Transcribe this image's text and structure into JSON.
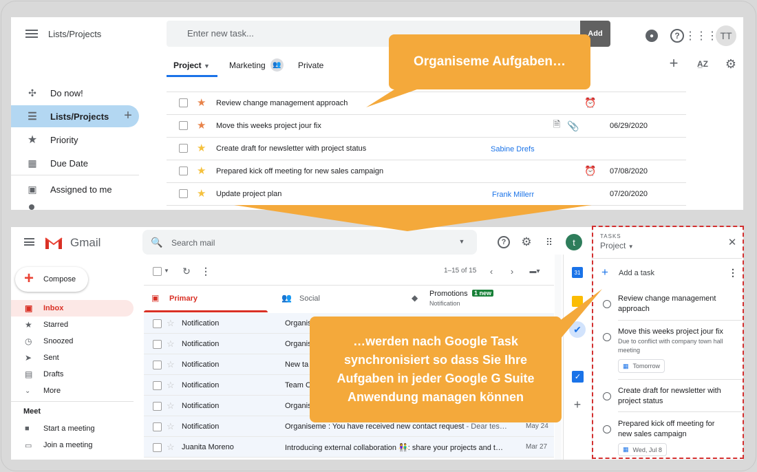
{
  "top_app": {
    "title": "Lists/Projects",
    "new_task_placeholder": "Enter new task...",
    "add_label": "Add",
    "avatar_initials": "TT",
    "tabs": [
      {
        "label": "Project",
        "active": true
      },
      {
        "label": "Marketing",
        "active": false
      },
      {
        "label": "Private",
        "active": false
      }
    ],
    "sidebar": [
      {
        "label": "Do now!",
        "icon": "gamepad-icon"
      },
      {
        "label": "Lists/Projects",
        "icon": "list-icon",
        "active": true
      },
      {
        "label": "Priority",
        "icon": "star-icon"
      },
      {
        "label": "Due Date",
        "icon": "calendar-icon"
      },
      {
        "label": "Assigned to me",
        "icon": "inbox-icon"
      }
    ],
    "tasks": [
      {
        "title": "Review change management approach",
        "star": "#e8834a",
        "assignee": "",
        "date": "",
        "alarm": true
      },
      {
        "title": "Move this weeks project jour fix",
        "star": "#e8834a",
        "assignee": "",
        "date": "06/29/2020",
        "attachments": true
      },
      {
        "title": "Create draft for newsletter with project status",
        "star": "#f5c13e",
        "assignee": "Sabine Drefs",
        "date": ""
      },
      {
        "title": "Prepared kick off meeting for new sales campaign",
        "star": "#f5c13e",
        "assignee": "",
        "date": "07/08/2020",
        "alarm": true
      },
      {
        "title": "Update project plan",
        "star": "#f5c13e",
        "assignee": "Frank Millerr",
        "date": "07/20/2020"
      }
    ]
  },
  "callouts": {
    "top": "Organiseme Aufgaben…",
    "bottom": "…werden nach Google Task synchronisiert so dass Sie Ihre Aufgaben in jeder Google G Suite Anwendung managen können"
  },
  "gmail": {
    "brand": "Gmail",
    "search_placeholder": "Search mail",
    "avatar_letter": "t",
    "compose_label": "Compose",
    "pagination": "1–15 of 15",
    "categories": [
      {
        "label": "Primary",
        "active": true
      },
      {
        "label": "Social",
        "active": false
      },
      {
        "label": "Promotions",
        "badge": "1 new",
        "sub": "Notification"
      }
    ],
    "sidebar": [
      {
        "label": "Inbox",
        "active": true,
        "icon": "inbox-icon"
      },
      {
        "label": "Starred",
        "icon": "star-icon"
      },
      {
        "label": "Snoozed",
        "icon": "clock-icon"
      },
      {
        "label": "Sent",
        "icon": "send-icon"
      },
      {
        "label": "Drafts",
        "icon": "draft-icon"
      },
      {
        "label": "More",
        "icon": "chevron-down-icon"
      }
    ],
    "meet_header": "Meet",
    "meet_items": [
      {
        "label": "Start a meeting",
        "icon": "video-icon"
      },
      {
        "label": "Join a meeting",
        "icon": "keyboard-icon"
      }
    ],
    "mails": [
      {
        "sender": "Notification",
        "subject": "Organis",
        "date": ""
      },
      {
        "sender": "Notification",
        "subject": "Organis",
        "date": ""
      },
      {
        "sender": "Notification",
        "subject": "New ta",
        "date": ""
      },
      {
        "sender": "Notification",
        "subject": "Team O",
        "date": ""
      },
      {
        "sender": "Notification",
        "subject": "Organis",
        "date": ""
      },
      {
        "sender": "Notification",
        "subject": "Organiseme : You have received new contact request",
        "snippet": " - Dear tes…",
        "date": "May 24"
      },
      {
        "sender": "Juanita Moreno",
        "subject": "Introducing external collaboration 👫: share your projects and t…",
        "snippet": "",
        "date": "Mar 27"
      }
    ]
  },
  "tasks_panel": {
    "header": "TASKS",
    "list_name": "Project",
    "add_label": "Add a task",
    "items": [
      {
        "title": "Review change management approach",
        "note": "",
        "chip": ""
      },
      {
        "title": "Move this weeks project jour fix",
        "note": "Due to conflict with company town hall meeting",
        "chip": "Tomorrow"
      },
      {
        "title": "Create draft for newsletter with project status",
        "note": "",
        "chip": ""
      },
      {
        "title": "Prepared kick off meeting for new sales campaign",
        "note": "",
        "chip": "Wed, Jul 8"
      }
    ]
  },
  "colors": {
    "accent_orange": "#f4a93b",
    "selected_blue": "#d3e3fd",
    "link_blue": "#1a73e8",
    "gmail_red": "#d93025",
    "dashed_red": "#d32f2f"
  }
}
